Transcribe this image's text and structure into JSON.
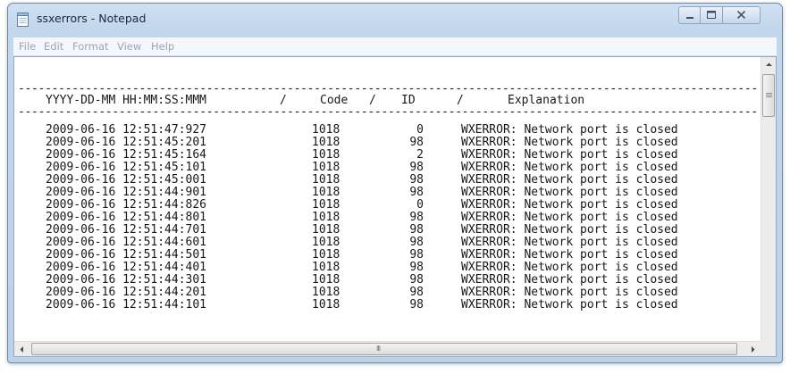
{
  "window": {
    "title": "ssxerrors - Notepad",
    "controls": [
      "minimize",
      "maximize",
      "close"
    ]
  },
  "menu": [
    "File",
    "Edit",
    "Format",
    "View",
    "Help"
  ],
  "document": {
    "rule": "------------------------------------------------------------------------------------------------------------------",
    "header": {
      "timestamp": "YYYY-DD-MM HH:MM:SS:MMM",
      "sep1": "/",
      "code": "Code",
      "sep2": "/",
      "id": "ID",
      "sep3": "/",
      "explanation": "Explanation"
    },
    "rows": [
      {
        "timestamp": "2009-06-16 12:51:47:927",
        "code": "1018",
        "id": "0",
        "explanation": "WXERROR: Network port is closed"
      },
      {
        "timestamp": "2009-06-16 12:51:45:201",
        "code": "1018",
        "id": "98",
        "explanation": "WXERROR: Network port is closed"
      },
      {
        "timestamp": "2009-06-16 12:51:45:164",
        "code": "1018",
        "id": "2",
        "explanation": "WXERROR: Network port is closed"
      },
      {
        "timestamp": "2009-06-16 12:51:45:101",
        "code": "1018",
        "id": "98",
        "explanation": "WXERROR: Network port is closed"
      },
      {
        "timestamp": "2009-06-16 12:51:45:001",
        "code": "1018",
        "id": "98",
        "explanation": "WXERROR: Network port is closed"
      },
      {
        "timestamp": "2009-06-16 12:51:44:901",
        "code": "1018",
        "id": "98",
        "explanation": "WXERROR: Network port is closed"
      },
      {
        "timestamp": "2009-06-16 12:51:44:826",
        "code": "1018",
        "id": "0",
        "explanation": "WXERROR: Network port is closed"
      },
      {
        "timestamp": "2009-06-16 12:51:44:801",
        "code": "1018",
        "id": "98",
        "explanation": "WXERROR: Network port is closed"
      },
      {
        "timestamp": "2009-06-16 12:51:44:701",
        "code": "1018",
        "id": "98",
        "explanation": "WXERROR: Network port is closed"
      },
      {
        "timestamp": "2009-06-16 12:51:44:601",
        "code": "1018",
        "id": "98",
        "explanation": "WXERROR: Network port is closed"
      },
      {
        "timestamp": "2009-06-16 12:51:44:501",
        "code": "1018",
        "id": "98",
        "explanation": "WXERROR: Network port is closed"
      },
      {
        "timestamp": "2009-06-16 12:51:44:401",
        "code": "1018",
        "id": "98",
        "explanation": "WXERROR: Network port is closed"
      },
      {
        "timestamp": "2009-06-16 12:51:44:301",
        "code": "1018",
        "id": "98",
        "explanation": "WXERROR: Network port is closed"
      },
      {
        "timestamp": "2009-06-16 12:51:44:201",
        "code": "1018",
        "id": "98",
        "explanation": "WXERROR: Network port is closed"
      },
      {
        "timestamp": "2009-06-16 12:51:44:101",
        "code": "1018",
        "id": "98",
        "explanation": "WXERROR: Network port is closed"
      }
    ]
  },
  "scrollbars": {
    "horizontal_grip": "III"
  },
  "icons": {
    "app": "notepad-icon",
    "minimize": "minimize-icon",
    "maximize": "maximize-icon",
    "close": "close-icon",
    "scroll_up": "scroll-up-arrow-icon",
    "scroll_left": "scroll-left-arrow-icon",
    "scroll_right": "scroll-right-arrow-icon"
  },
  "colors": {
    "title_text": "#1b2a3a",
    "menu_text_inactive": "#9aa6b4",
    "document_text": "#18181c",
    "frame": "#c2d6ec"
  }
}
